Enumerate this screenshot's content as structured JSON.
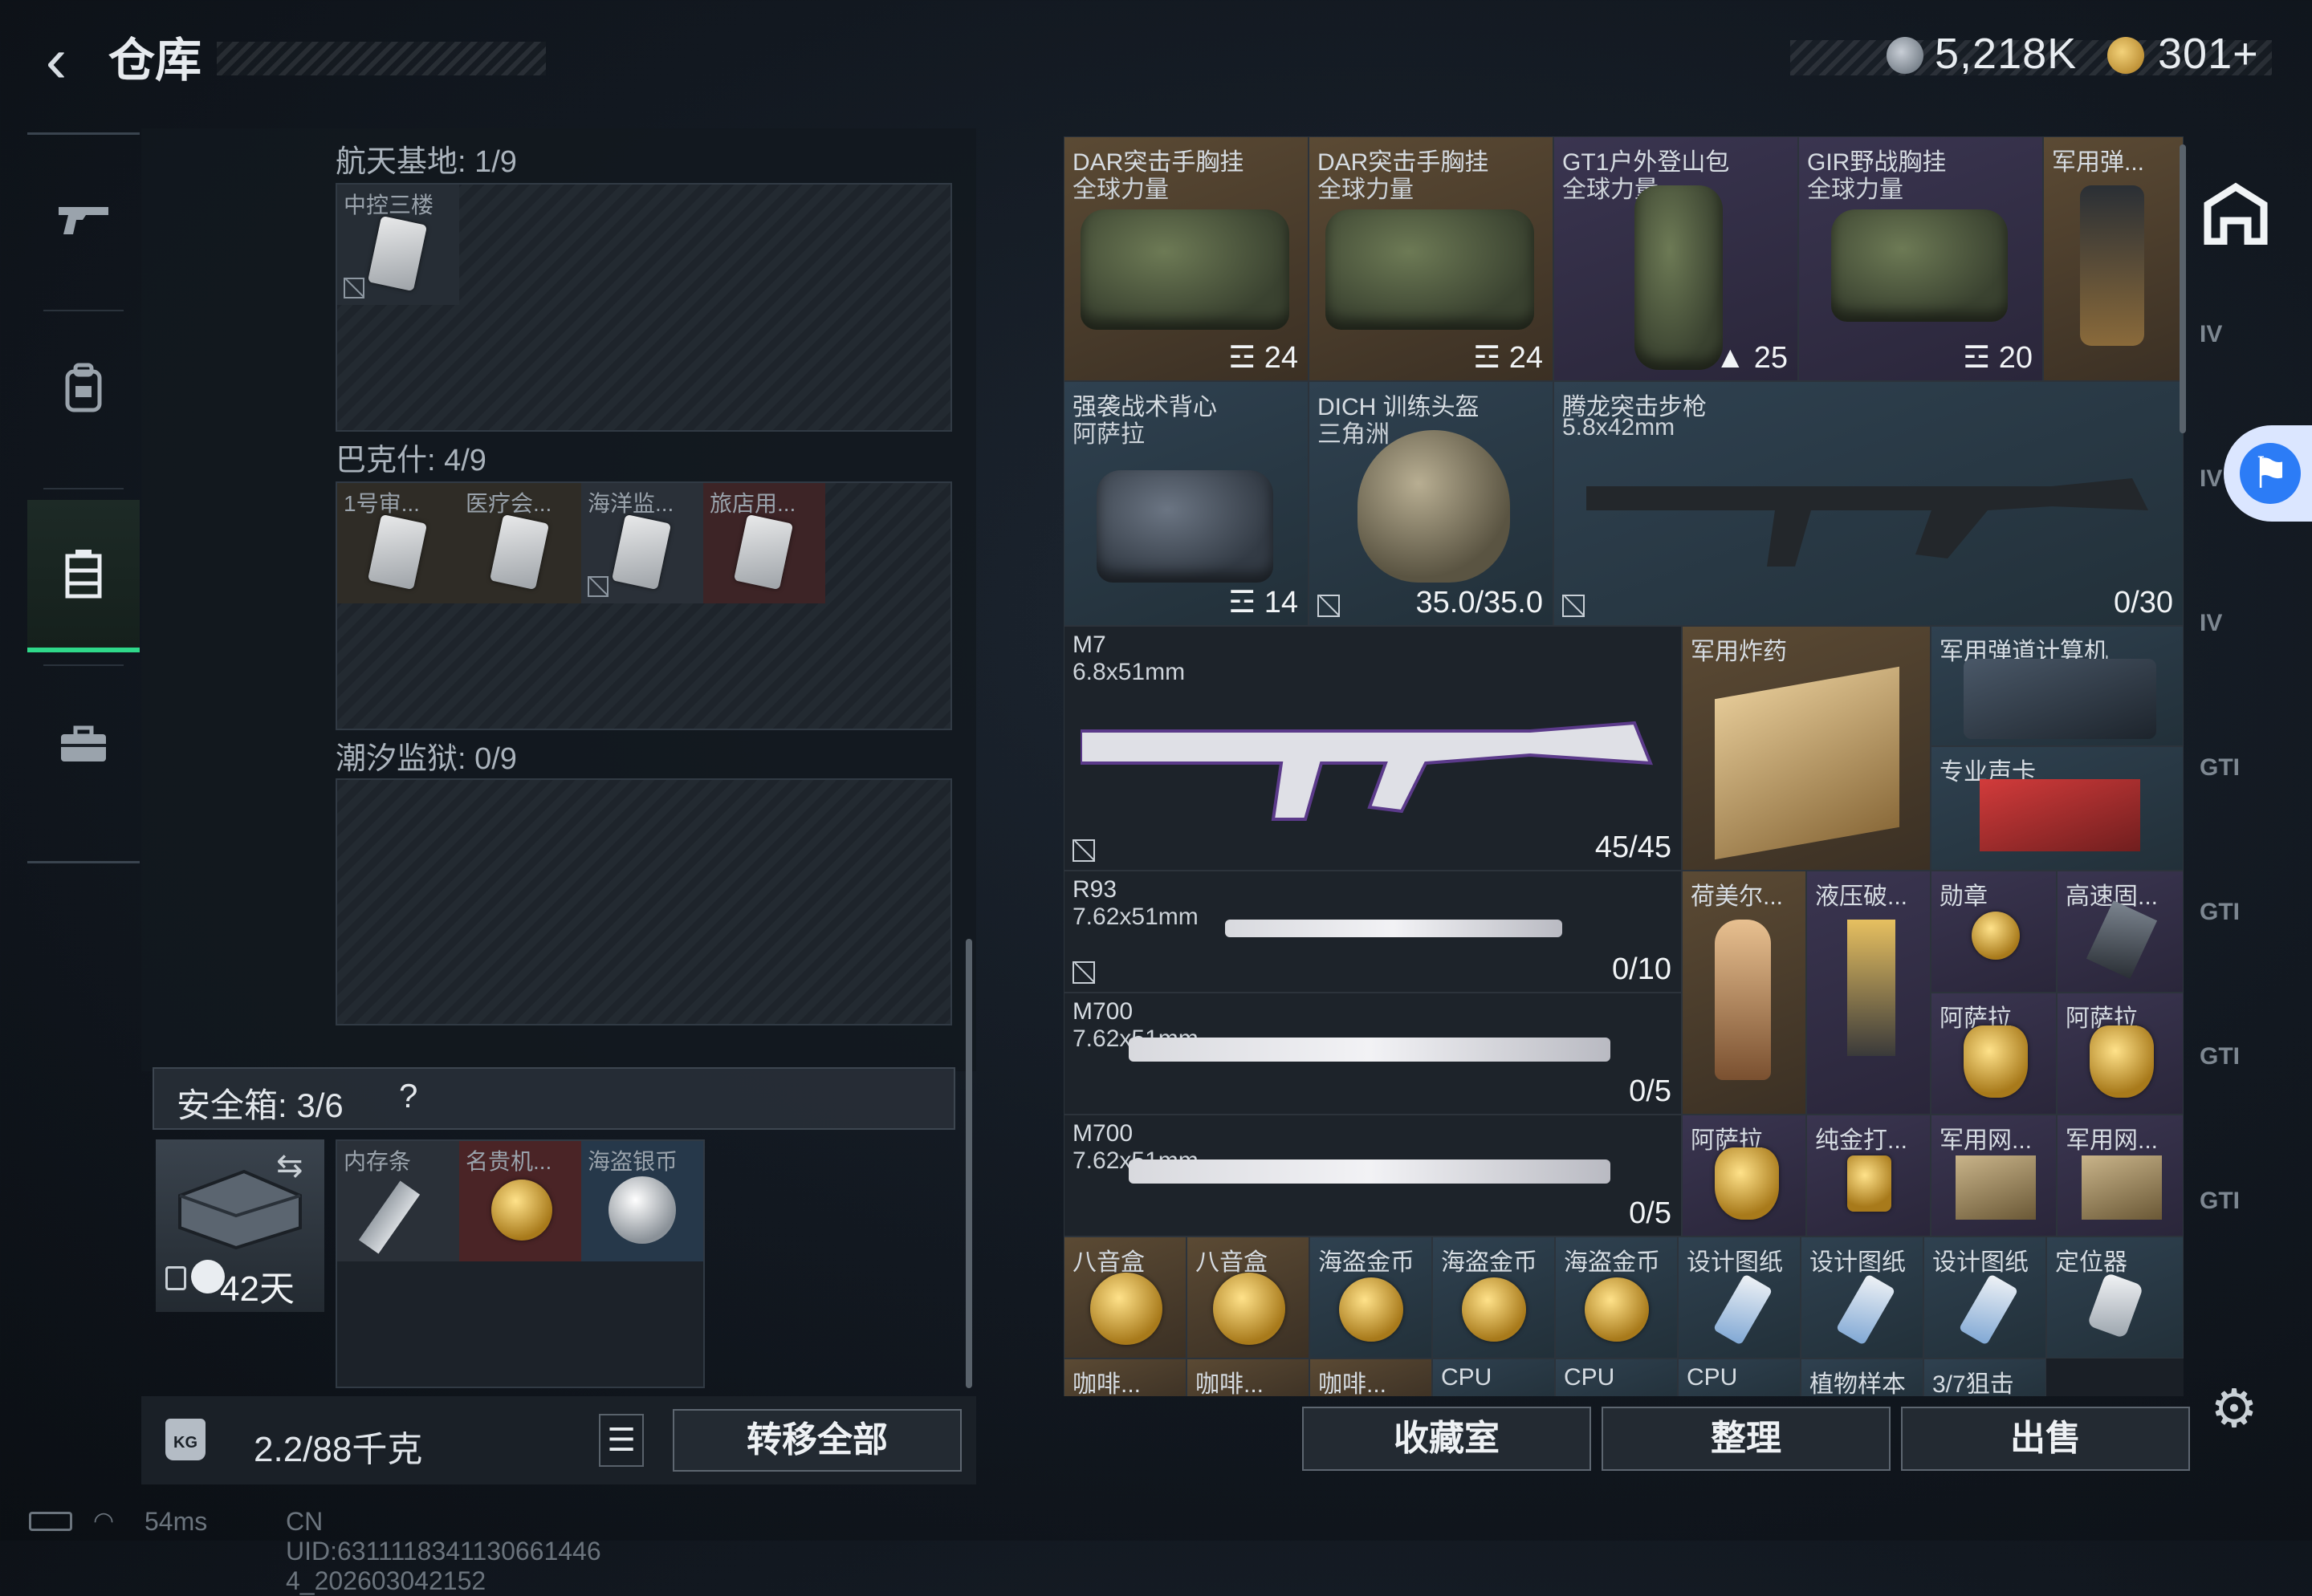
{
  "header": {
    "title": "仓库",
    "currency": [
      {
        "icon": "silver-coin-icon",
        "value": "5,218K"
      },
      {
        "icon": "gold-coin-icon",
        "value": "301+"
      }
    ]
  },
  "left_nav": [
    {
      "icon": "gun-icon"
    },
    {
      "icon": "backpack-icon"
    },
    {
      "icon": "locker-icon",
      "active": true
    },
    {
      "icon": "briefcase-icon"
    }
  ],
  "stash_sections": [
    {
      "label": "航天基地: 1/9",
      "items": [
        "中控三楼"
      ]
    },
    {
      "label": "巴克什: 4/9",
      "items": [
        "1号审...",
        "医疗会...",
        "海洋监...",
        "旅店用..."
      ]
    },
    {
      "label": "潮汐监狱: 0/9",
      "items": []
    }
  ],
  "safe_box": {
    "title": "安全箱: 3/6",
    "help": "?",
    "days": "42天",
    "items": [
      "内存条",
      "名贵机...",
      "海盗银币"
    ]
  },
  "weight": {
    "value": "2.2/88千克",
    "icon_text": "KG"
  },
  "buttons": {
    "transfer_all": "转移全部",
    "list_icon": "☰",
    "collection": "收藏室",
    "sort": "整理",
    "sell": "出售"
  },
  "inventory": {
    "row1": [
      {
        "name": "DAR突击手胸挂",
        "sub": "全球力量",
        "qty": "24"
      },
      {
        "name": "DAR突击手胸挂",
        "sub": "全球力量",
        "qty": "24"
      },
      {
        "name": "GT1户外登山包",
        "sub": "全球力量",
        "qty": "25"
      },
      {
        "name": "GIR野战胸挂",
        "sub": "全球力量",
        "qty": "20"
      },
      {
        "name": "军用弹..."
      }
    ],
    "row2": [
      {
        "name": "强袭战术背心",
        "sub": "阿萨拉",
        "qty": "14"
      },
      {
        "name": "DICH 训练头盔",
        "sub": "三角洲",
        "qty": "35.0/35.0"
      },
      {
        "name": "腾龙突击步枪",
        "sub": "5.8x42mm",
        "qty": "0/30"
      }
    ],
    "m7": {
      "name": "M7",
      "sub": "6.8x51mm",
      "qty": "45/45"
    },
    "explosive": "军用炸药",
    "ballistic": "军用弹道计算机",
    "soundcard": "专业声卡",
    "r93": {
      "name": "R93",
      "sub": "7.62x51mm",
      "qty": "0/10"
    },
    "m700a": {
      "name": "M700",
      "sub": "7.62x51mm",
      "qty": "0/5"
    },
    "m700b": {
      "name": "M700",
      "sub": "7.62x51mm",
      "qty": "0/5"
    },
    "small_row1": [
      "荷美尔...",
      "液压破...",
      "勋章",
      "高速固..."
    ],
    "small_row2": [
      "阿萨拉",
      "阿萨拉"
    ],
    "small_row3": [
      "阿萨拉",
      "纯金打...",
      "军用网...",
      "军用网..."
    ],
    "bottom_row": [
      "八音盒",
      "八音盒",
      "海盗金币",
      "海盗金币",
      "海盗金币",
      "设计图纸",
      "设计图纸",
      "设计图纸",
      "定位器"
    ],
    "partial_row": [
      "咖啡...",
      "咖啡...",
      "咖啡...",
      "CPU",
      "CPU",
      "CPU",
      "植物样本",
      "3/7狙击"
    ]
  },
  "right_nav": [
    {
      "icon": "warehouse-icon",
      "label": ""
    },
    {
      "icon": "tier-iv-case-icon",
      "label": "IV"
    },
    {
      "icon": "tier-iv-case-icon",
      "label": "IV"
    },
    {
      "icon": "tier-iv-case-icon",
      "label": "IV"
    },
    {
      "icon": "gti-case-icon",
      "label": "GTI"
    },
    {
      "icon": "gti-case-icon",
      "label": "GTI"
    },
    {
      "icon": "gti-case-icon",
      "label": "GTI"
    },
    {
      "icon": "gti-case-icon",
      "label": "GTI"
    }
  ],
  "status": {
    "ping": "54ms",
    "uid": "CN UID:6311118341130661446 4_202603042152"
  }
}
